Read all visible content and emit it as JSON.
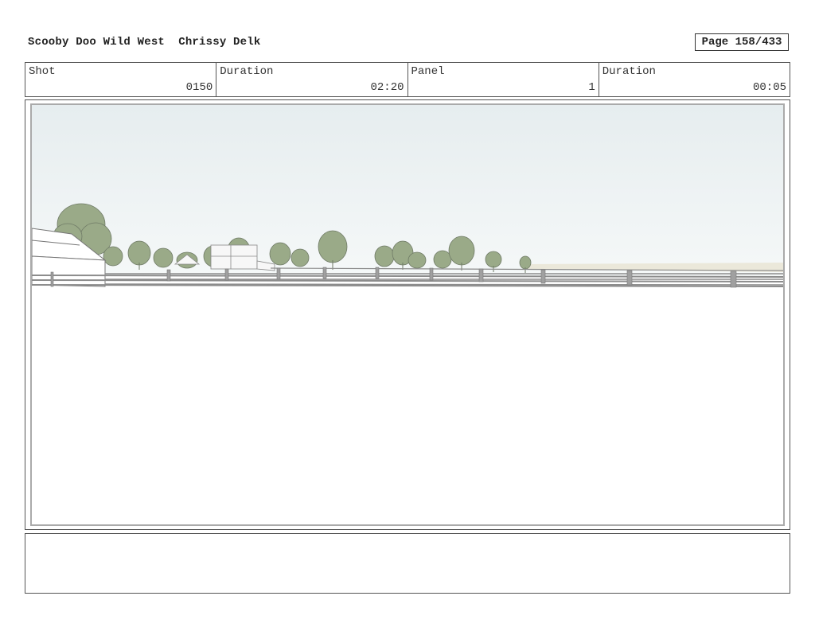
{
  "header": {
    "title": "Scooby Doo Wild West  Chrissy Delk",
    "page": "Page 158/433"
  },
  "info": {
    "shot_label": "Shot",
    "shot_value": "0150",
    "duration_label": "Duration",
    "duration_value": "02:20",
    "panel_label": "Panel",
    "panel_value": "1",
    "panel_duration_label": "Duration",
    "panel_duration_value": "00:05"
  },
  "notes": {
    "text": ""
  },
  "colors": {
    "sky_top": "#e6edef",
    "sky_bottom": "#f3f7f7",
    "tree_fill": "#9aaa88",
    "fence": "#8c8c8c",
    "horizon_line": "#e5e2d2"
  }
}
